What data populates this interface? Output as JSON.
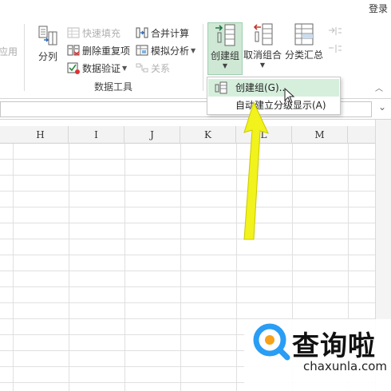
{
  "header": {
    "login": "登录"
  },
  "ribbon": {
    "faded_left_label": "应用",
    "text_to_columns": "分列",
    "flash_fill": "快速填充",
    "remove_duplicates": "删除重复项",
    "data_validation": "数据验证",
    "consolidate": "合并计算",
    "what_if": "模拟分析",
    "relationships": "关系",
    "group_label_data_tools": "数据工具",
    "group_button": "创建组",
    "ungroup_button": "取消组合",
    "subtotal_button": "分类汇总"
  },
  "dropdown": {
    "item_group": "创建组(G)...",
    "item_auto_outline": "自动建立分级显示(A)"
  },
  "sheet": {
    "columns": [
      "H",
      "I",
      "J",
      "K",
      "L",
      "M"
    ]
  },
  "watermark": {
    "logo_text": "查询啦",
    "url": "chaxunla.com"
  },
  "colors": {
    "accent_green": "#217346",
    "arrow_yellow": "#f2f21c",
    "hover_green": "#d6efdd",
    "active_button": "#cfe8d5",
    "logo_blue": "#2a9df4",
    "logo_orange": "#f7a21b"
  }
}
